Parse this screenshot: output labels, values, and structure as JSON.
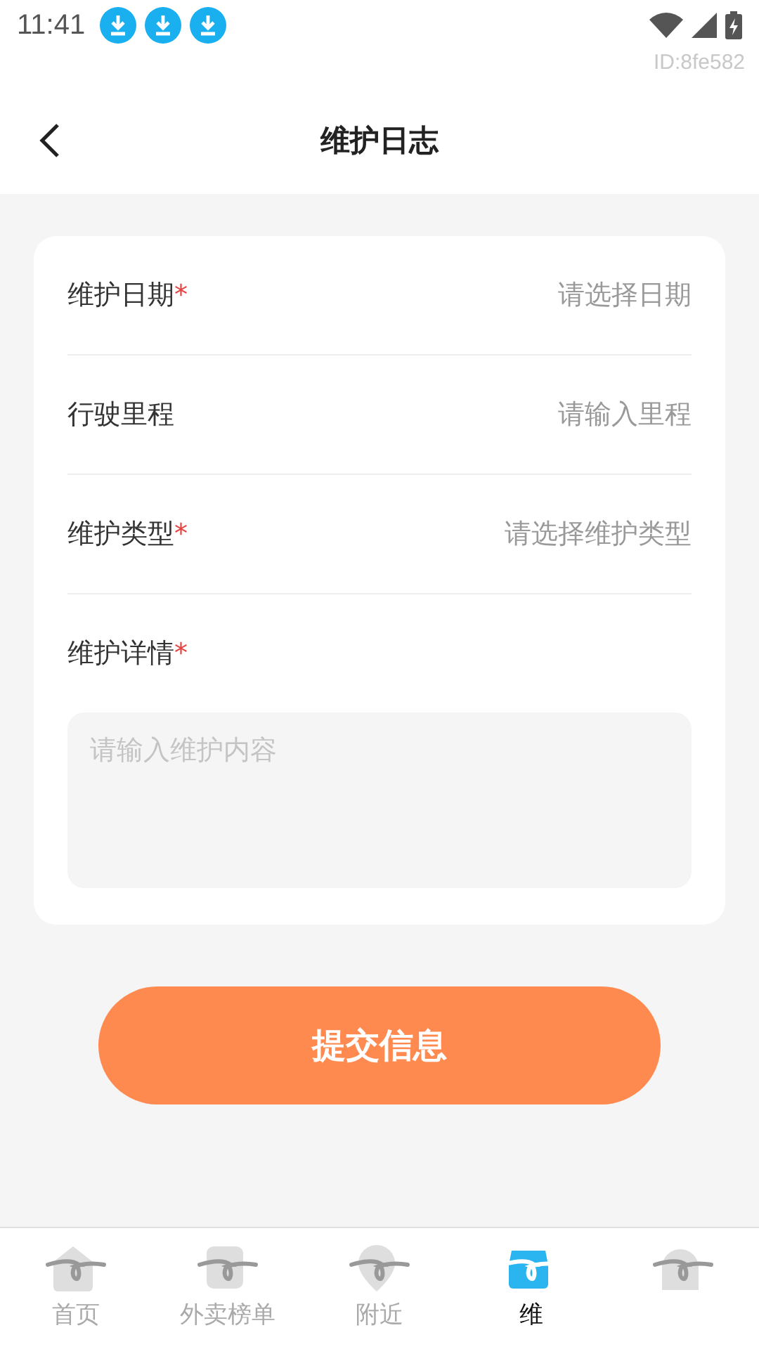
{
  "status_bar": {
    "time": "11:41",
    "notifications": [
      {
        "kind": "download"
      },
      {
        "kind": "download"
      },
      {
        "kind": "download"
      }
    ],
    "device_id": "ID:8fe582"
  },
  "header": {
    "title": "维护日志"
  },
  "form": {
    "fields": [
      {
        "kind": "select",
        "label": "维护日期",
        "required": true,
        "placeholder": "请选择日期"
      },
      {
        "kind": "input",
        "label": "行驶里程",
        "required": false,
        "placeholder": "请输入里程"
      },
      {
        "kind": "select",
        "label": "维护类型",
        "required": true,
        "placeholder": "请选择维护类型"
      },
      {
        "kind": "textarea",
        "label": "维护详情",
        "required": true,
        "placeholder": "请输入维护内容"
      }
    ],
    "required_mark": "*"
  },
  "submit": "提交信息",
  "tabs": [
    {
      "label": "首页",
      "selected": false
    },
    {
      "label": "外卖榜单",
      "selected": false
    },
    {
      "label": "附近",
      "selected": false
    },
    {
      "label": "维",
      "selected": true
    },
    {
      "selected": false
    }
  ]
}
